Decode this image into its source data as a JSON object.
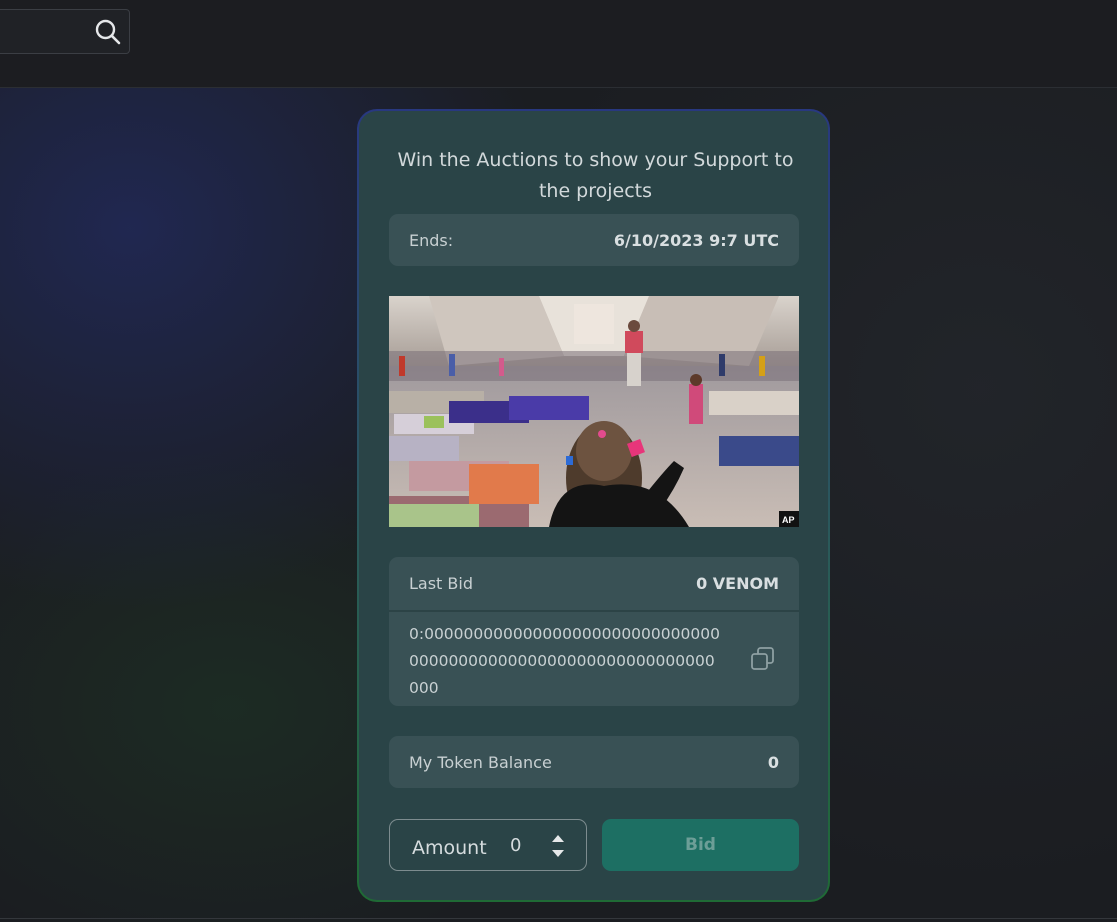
{
  "search": {
    "placeholder": ""
  },
  "card": {
    "heading": "Win the Auctions to show your Support to the projects",
    "ends": {
      "label": "Ends:",
      "value": "6/10/2023 9:7 UTC"
    },
    "image": {
      "badge": "AP"
    },
    "last_bid": {
      "label": "Last Bid",
      "value": "0 VENOM",
      "address": "0:0000000000000000000000000000000000000000000000000000000000000000"
    },
    "balance": {
      "label": "My Token Balance",
      "value": "0"
    },
    "amount": {
      "label": "Amount",
      "value": "0"
    },
    "bid_button": "Bid"
  },
  "colors": {
    "card_bg": "#2a4447",
    "pill_bg": "#395155",
    "bid_button_bg": "#1d6f63"
  }
}
